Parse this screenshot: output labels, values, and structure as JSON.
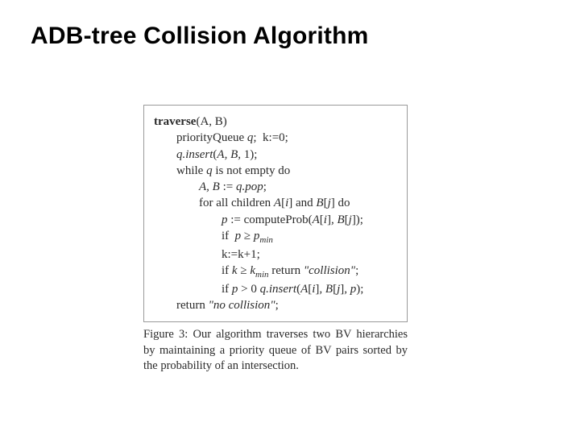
{
  "title": "ADB-tree Collision Algorithm",
  "algorithm": {
    "fn_name": "traverse",
    "fn_args": "(A, B)",
    "lines": {
      "l1_a": "priorityQueue ",
      "l1_b": "q",
      "l1_c": ";  k:=0;",
      "l2_a": "q.insert",
      "l2_b": "(",
      "l2_c": "A, B, ",
      "l2_d": "1);",
      "l3_a": "while ",
      "l3_b": "q",
      "l3_c": " is not empty do",
      "l4_a": "A, B ",
      "l4_b": ":= ",
      "l4_c": "q.pop",
      "l4_d": ";",
      "l5_a": "for all children ",
      "l5_b": "A",
      "l5_c": "[",
      "l5_d": "i",
      "l5_e": "] and ",
      "l5_f": "B",
      "l5_g": "[",
      "l5_h": "j",
      "l5_i": "] do",
      "l6_a": "p ",
      "l6_b": ":= computeProb(",
      "l6_c": "A",
      "l6_d": "[",
      "l6_e": "i",
      "l6_f": "]",
      "l6_g": ", B",
      "l6_h": "[",
      "l6_i": "j",
      "l6_j": "]);",
      "l7_a": "if  ",
      "l7_b": "p ",
      "l7_c": "≥ ",
      "l7_d": "p",
      "l7_e": "min",
      "l8_a": "k:=k+1;",
      "l9_a": "if ",
      "l9_b": "k ",
      "l9_c": "≥ ",
      "l9_d": "k",
      "l9_e": "min",
      "l9_f": " return ",
      "l9_g": "\"collision\"",
      "l9_h": ";",
      "l10_a": "if ",
      "l10_b": "p ",
      "l10_c": "> 0 ",
      "l10_d": "q.insert",
      "l10_e": "(",
      "l10_f": "A",
      "l10_g": "[",
      "l10_h": "i",
      "l10_i": "]",
      "l10_j": ", B",
      "l10_k": "[",
      "l10_l": "j",
      "l10_m": "]",
      "l10_n": ", p",
      "l10_o": ");",
      "l11_a": "return ",
      "l11_b": "\"no collision\"",
      "l11_c": ";"
    }
  },
  "caption": "Figure 3:  Our algorithm traverses two BV hierarchies by maintaining a priority queue of BV pairs sorted by the probability of an intersection."
}
